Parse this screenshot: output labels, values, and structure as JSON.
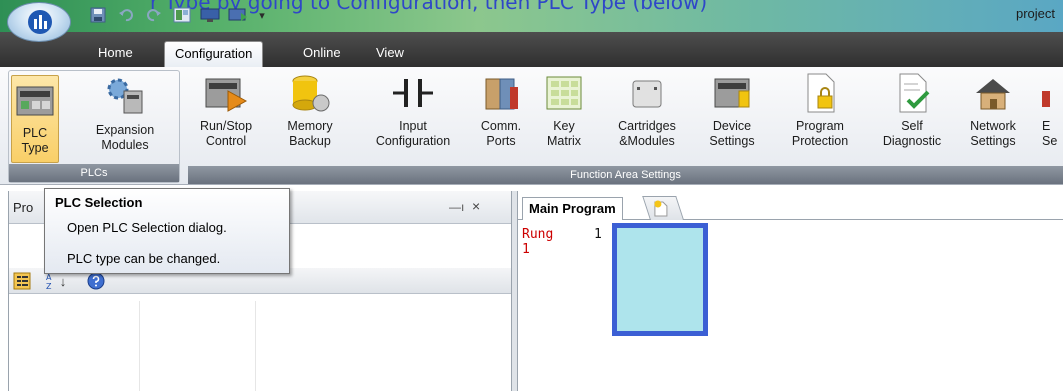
{
  "titlebar": {
    "title": "project",
    "overlay_text": "r Type by going to Configuration, then PLC Type (below)",
    "colors": {
      "gradient_start": "#2e8f55",
      "gradient_end": "#5aa7c4"
    },
    "quick_access": [
      "save-icon",
      "undo-icon",
      "redo-icon",
      "layout-icon",
      "monitor-icon",
      "download-icon",
      "chevron-down-icon"
    ]
  },
  "tabs": [
    {
      "label": "Home",
      "active": false
    },
    {
      "label": "Configuration",
      "active": true
    },
    {
      "label": "Online",
      "active": false
    },
    {
      "label": "View",
      "active": false
    }
  ],
  "ribbon": {
    "plcs_group": {
      "label": "PLCs",
      "buttons": [
        {
          "line1": "PLC",
          "line2": "Type",
          "icon": "plc-type-icon",
          "pressed": true
        },
        {
          "line1": "Expansion",
          "line2": "Modules",
          "icon": "expansion-modules-icon",
          "pressed": false
        }
      ]
    },
    "function_group": {
      "label": "Function Area Settings",
      "buttons": [
        {
          "line1": "Run/Stop",
          "line2": "Control",
          "icon": "run-stop-icon"
        },
        {
          "line1": "Memory",
          "line2": "Backup",
          "icon": "memory-backup-icon"
        },
        {
          "line1": "Input",
          "line2": "Configuration",
          "icon": "input-contact-icon"
        },
        {
          "line1": "Comm.",
          "line2": "Ports",
          "icon": "comm-ports-icon"
        },
        {
          "line1": "Key",
          "line2": "Matrix",
          "icon": "key-matrix-icon"
        },
        {
          "line1": "Cartridges",
          "line2": "&Modules",
          "icon": "cartridge-icon"
        },
        {
          "line1": "Device",
          "line2": "Settings",
          "icon": "device-settings-icon"
        },
        {
          "line1": "Program",
          "line2": "Protection",
          "icon": "program-protection-icon"
        },
        {
          "line1": "Self",
          "line2": "Diagnostic",
          "icon": "self-diagnostic-icon"
        },
        {
          "line1": "Network",
          "line2": "Settings",
          "icon": "network-settings-icon"
        },
        {
          "line1": "E",
          "line2": "Se",
          "icon": "partial-icon"
        }
      ]
    }
  },
  "properties": {
    "title": "Pro",
    "pin_glyph": "—ı",
    "close_glyph": "×",
    "toolbar_icons": [
      "categorized-icon",
      "sort-az-icon",
      "help-icon"
    ],
    "sort_glyph": "↓"
  },
  "tooltip": {
    "title": "PLC Selection",
    "line1": "Open PLC Selection dialog.",
    "line2": "PLC type can be changed."
  },
  "main": {
    "tab_label": "Main Program",
    "rung_label": "Rung",
    "rung_index": "1",
    "rung_number": "1",
    "colors": {
      "cell_fill": "#aee4ec",
      "cell_border": "#3b5fd4",
      "rung_text": "#cc0000"
    }
  }
}
